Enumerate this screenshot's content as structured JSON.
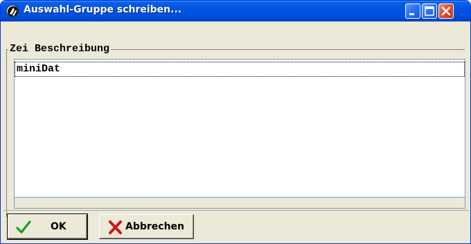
{
  "window": {
    "title": "Auswahl-Gruppe schreiben...",
    "icons": {
      "app": "app-icon",
      "minimize": "minimize-icon",
      "maximize": "maximize-icon",
      "close": "close-icon"
    }
  },
  "list": {
    "header": "Zei Beschreibung",
    "items": [
      {
        "label": "miniDat",
        "selected": true
      }
    ]
  },
  "buttons": {
    "ok_label": "OK",
    "cancel_label": "Abbrechen",
    "ok_icon": "checkmark-icon",
    "cancel_icon": "red-x-icon"
  },
  "colors": {
    "titlebar": "#0054e3",
    "close_button": "#e0492a",
    "window_bg": "#ece9d8",
    "ok_check": "#1a9e1a",
    "cancel_x": "#cc1a1a"
  }
}
